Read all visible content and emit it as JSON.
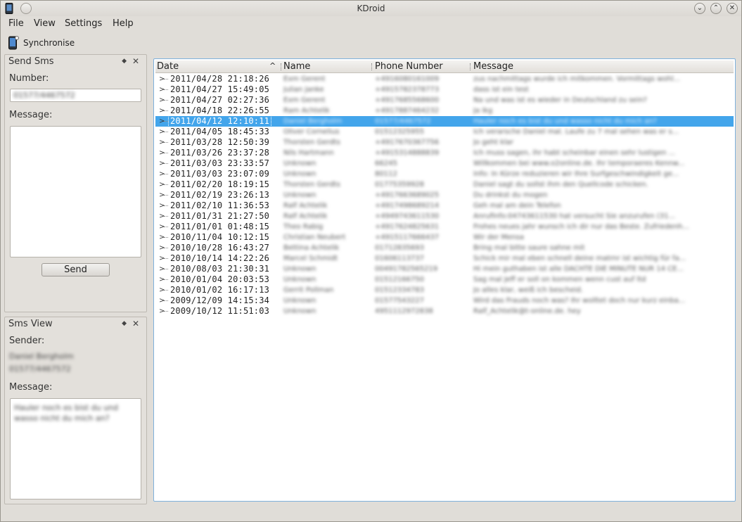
{
  "window": {
    "title": "KDroid"
  },
  "titlebar_buttons": {
    "minimize": "⌄",
    "maximize": "⌃",
    "close": "✕"
  },
  "menu": {
    "file": "File",
    "view": "View",
    "settings": "Settings",
    "help": "Help"
  },
  "toolbar": {
    "synchronise": "Synchronise"
  },
  "send_sms": {
    "title": "Send Sms",
    "number_label": "Number:",
    "number_value": "01577/4467572",
    "message_label": "Message:",
    "send_button": "Send"
  },
  "sms_view": {
    "title": "Sms View",
    "sender_label": "Sender:",
    "sender_name": "Daniel Bergholm",
    "sender_number": "01577/4467572",
    "message_label": "Message:",
    "message_text": "Hauler noch es bist du und wasso nicht du mich an?"
  },
  "table": {
    "headers": {
      "date": "Date",
      "name": "Name",
      "phone": "Phone Number",
      "message": "Message"
    },
    "selected_index": 4,
    "rows": [
      {
        "date": "2011/04/28 21:18:26",
        "name": "Exm Gerent",
        "phone": "+4916080161009",
        "message": "zus nachmittags wurde ich mitkommen. Vormittags wohl..."
      },
      {
        "date": "2011/04/27 15:49:05",
        "name": "Julian Janke",
        "phone": "+4915782378773",
        "message": "dass ist ein test"
      },
      {
        "date": "2011/04/27 02:27:36",
        "name": "Exm Gerent",
        "phone": "+4917685568600",
        "message": "Na und was ist es wieder in Deutschland zu sein?"
      },
      {
        "date": "2011/04/18 22:26:55",
        "name": "Ram Achtelik",
        "phone": "+4917887464232",
        "message": "Ja ikg"
      },
      {
        "date": "2011/04/12 12:10:11",
        "name": "Daniel Bergholm",
        "phone": "01577/4467572",
        "message": "Hauler noch es bist du und wasso nicht du mich an?"
      },
      {
        "date": "2011/04/05 18:45:33",
        "name": "Oliver Cornelius",
        "phone": "01512325955",
        "message": "Ich verarsche Daniel mal. Laufe zu 7 mal sehen was er s..."
      },
      {
        "date": "2011/03/28 12:50:39",
        "name": "Thorsten Gerdts",
        "phone": "+4917670367756",
        "message": "Jo geht klar"
      },
      {
        "date": "2011/03/26 23:37:28",
        "name": "Nils Hartmann",
        "phone": "+4915314888839",
        "message": "Ich muss sagen, ihr habt scheinbar einen sehr lustigen ..."
      },
      {
        "date": "2011/03/03 23:33:57",
        "name": "Unknown",
        "phone": "66245",
        "message": "Willkommen bei www.o2online.de. Ihr temporaeres Kennw..."
      },
      {
        "date": "2011/03/03 23:07:09",
        "name": "Unknown",
        "phone": "80112",
        "message": "Info: In Kürze reduzieren wir Ihre Surfgeschwindigkeit ge..."
      },
      {
        "date": "2011/02/20 18:19:15",
        "name": "Thorsten Gerdts",
        "phone": "01775359928",
        "message": "Daniel sagt du sollst ihm den Quellcode schicken."
      },
      {
        "date": "2011/02/19 23:26:13",
        "name": "Unknown",
        "phone": "+4917663689025",
        "message": "Du drinkst du mogen"
      },
      {
        "date": "2011/02/10 11:36:53",
        "name": "Ralf Achtelik",
        "phone": "+4917498689214",
        "message": "Geh mal am dein Telefon"
      },
      {
        "date": "2011/01/31 21:27:50",
        "name": "Ralf Achtelik",
        "phone": "+4949743611530",
        "message": "Anrufinfo:04743611530 hat versucht Sie anzurufen (31..."
      },
      {
        "date": "2011/01/01 01:48:15",
        "name": "Theo Rabig",
        "phone": "+4917624825631",
        "message": "Frohes neues jahr wunsch ich dir nur das Beste. Zufriedenh..."
      },
      {
        "date": "2010/11/04 10:12:15",
        "name": "Christian Neubert",
        "phone": "+4915117666437",
        "message": "Wir der Mensa"
      },
      {
        "date": "2010/10/28 16:43:27",
        "name": "Bettina Achtelik",
        "phone": "01712835693",
        "message": "Bring mal bitte saure sahne mit"
      },
      {
        "date": "2010/10/14 14:22:26",
        "name": "Marcel Schmidt",
        "phone": "01606113737",
        "message": "Schick mir mal eben schnell deine matrnr ist wichtig für fa..."
      },
      {
        "date": "2010/08/03 21:30:31",
        "name": "Unknown",
        "phone": "00491782565219",
        "message": "Hi mein guthaben ist alle DACHTE DIE MINUTE NUR 14 CE..."
      },
      {
        "date": "2010/01/04 20:03:53",
        "name": "Unknown",
        "phone": "01512166750",
        "message": "Sag mal Jeff er soll on kommen wenn cust auf ltd"
      },
      {
        "date": "2010/01/02 16:17:13",
        "name": "Gerrit Pollman",
        "phone": "01512334783",
        "message": "Jo alles klar, weiß ich bescheid."
      },
      {
        "date": "2009/12/09 14:15:34",
        "name": "Unknown",
        "phone": "01577543227",
        "message": "Wird das Frauds noch was? Ihr wolltet doch nur kurz einba..."
      },
      {
        "date": "2009/10/12 11:51:03",
        "name": "Unknown",
        "phone": "4951112972838",
        "message": "Ralf_Achtelik@t-online.de. hey"
      }
    ]
  },
  "colors": {
    "selection": "#43a5eb",
    "frame_focus": "#7fb1dc",
    "window_bg": "#e0ddd8"
  },
  "icons": {
    "app": "phone-icon",
    "sync": "phone-sync-icon",
    "pin": "pin-icon"
  }
}
